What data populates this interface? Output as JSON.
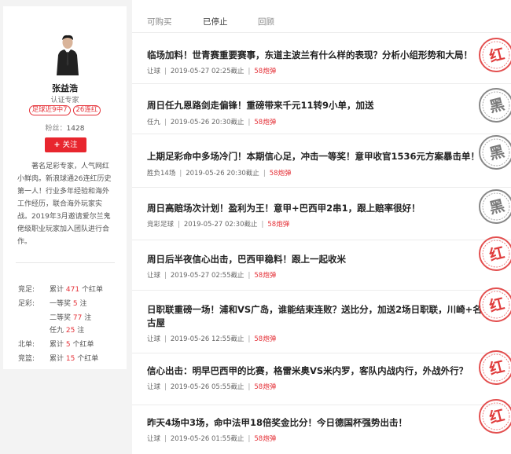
{
  "profile": {
    "name": "张益浩",
    "certification": "认证专家",
    "tags": [
      "足球近9中7",
      "26连红"
    ],
    "fans_label": "粉丝：",
    "fans_count": "1428",
    "follow_label": "关注",
    "follow_icon": "plus-icon",
    "bio": "著名足彩专家，人气网红小鲜肉。新浪球通26连红历史第一人！行业多年经验和海外工作经历，联合海外玩家实战。2019年3月邀请爱尔兰鬼佬级职业玩家加入团队进行合作。",
    "stats": [
      {
        "label": "竞足:",
        "prefix": "累计",
        "value": "471",
        "suffix": "个红单"
      },
      {
        "label": "足彩:",
        "prefix": "一等奖",
        "value": "5",
        "suffix": "注"
      },
      {
        "label": "",
        "prefix": "二等奖",
        "value": "77",
        "suffix": "注"
      },
      {
        "label": "",
        "prefix": "任九",
        "value": "25",
        "suffix": "注"
      },
      {
        "label": "北单:",
        "prefix": "累计",
        "value": "5",
        "suffix": "个红单"
      },
      {
        "label": "竞篮:",
        "prefix": "累计",
        "value": "15",
        "suffix": "个红单"
      }
    ]
  },
  "tabs": [
    "可购买",
    "已停止",
    "回顾"
  ],
  "active_tab": "已停止",
  "colors": {
    "accent": "#e8262e",
    "red_stamp": "#e03c3c",
    "black_stamp": "#7a7a7a"
  },
  "articles": [
    {
      "title": "临场加料！世青赛重要赛事，东道主波兰有什么样的表现？分析小组形势和大局！",
      "category": "让球",
      "time": "2019-05-27 02:25截止",
      "price": "58炮弹",
      "stamp": "红"
    },
    {
      "title": "周日任九恩路剑走偏锋！重磅带来千元11转9小单，加送",
      "category": "任九",
      "time": "2019-05-26 20:30截止",
      "price": "58炮弹",
      "stamp": "黑"
    },
    {
      "title": "上期足彩命中多场冷门！本期信心足，冲击一等奖！意甲收官1536元方案暴击单！",
      "category": "胜负14场",
      "time": "2019-05-26 20:30截止",
      "price": "58炮弹",
      "stamp": "黑"
    },
    {
      "title": "周日高赔场次计划！盈利为王！意甲+巴西甲2串1，跟上赔率很好！",
      "category": "竞彩足球",
      "time": "2019-05-27 02:30截止",
      "price": "58炮弹",
      "stamp": "黑"
    },
    {
      "title": "周日后半夜信心出击，巴西甲稳料！跟上一起收米",
      "category": "让球",
      "time": "2019-05-27 02:55截止",
      "price": "58炮弹",
      "stamp": "红"
    },
    {
      "title": "日职联重磅一场！浦和VS广岛，谁能结束连败？送比分，加送2场日职联，川崎+名古屋",
      "category": "让球",
      "time": "2019-05-26 12:55截止",
      "price": "58炮弹",
      "stamp": "红"
    },
    {
      "title": "信心出击：明早巴西甲的比赛，格雷米奥VS米内罗，客队内战内行，外战外行？",
      "category": "让球",
      "time": "2019-05-26 05:55截止",
      "price": "58炮弹",
      "stamp": "红"
    },
    {
      "title": "昨天4场中3场，命中法甲18倍奖金比分！今日德国杯强势出击！",
      "category": "让球",
      "time": "2019-05-26 01:55截止",
      "price": "58炮弹",
      "stamp": "红"
    }
  ]
}
